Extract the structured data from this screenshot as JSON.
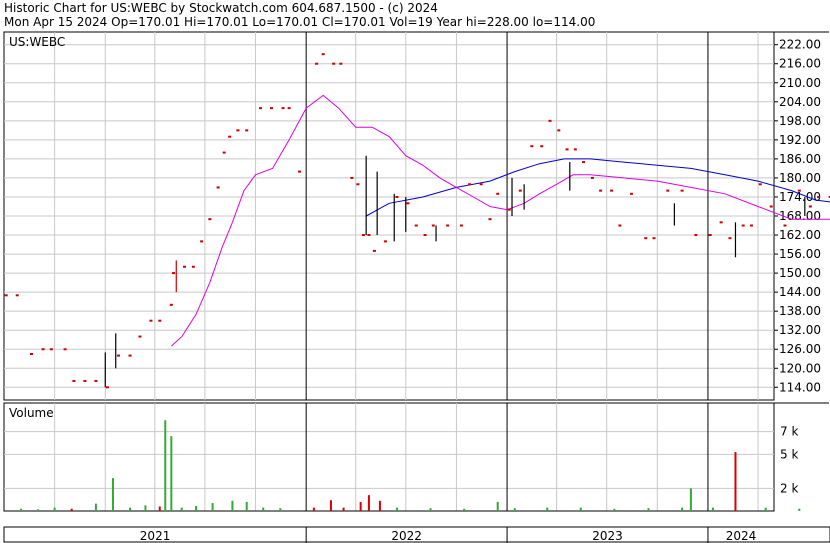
{
  "header": {
    "line1": "Historic Chart for US:WEBC by Stockwatch.com 604.687.1500 - (c) 2024",
    "line2": "Mon Apr 15 2024   Op=170.01  Hi=170.01  Lo=170.01  Cl=170.01  Vol=19   Year hi=228.00  lo=114.00"
  },
  "chart_data": [
    {
      "type": "line",
      "title": "US:WEBC",
      "y_ticks": [
        "222.00",
        "216.00",
        "210.00",
        "204.00",
        "198.00",
        "192.00",
        "186.00",
        "180.00",
        "174.00",
        "168.00",
        "162.00",
        "156.00",
        "150.00",
        "144.00",
        "138.00",
        "132.00",
        "126.00",
        "120.00",
        "114.00"
      ],
      "ylim": [
        110,
        226
      ],
      "x_labels": [
        "2021",
        "2022",
        "2023",
        "2024"
      ],
      "xlim": [
        "2020-07-01",
        "2024-04-30"
      ],
      "year_boundaries": [
        "2022-01-01",
        "2023-01-01",
        "2024-01-01"
      ],
      "grid": true,
      "colors": {
        "bars": "#cc0000",
        "up_bars": "#000000",
        "ma_long": "#0000cc",
        "ma_short": "#e000e0"
      },
      "price_points": [
        {
          "x": "2020-07-05",
          "y": 143
        },
        {
          "x": "2020-07-25",
          "y": 143
        },
        {
          "x": "2020-08-20",
          "y": 124.5
        },
        {
          "x": "2020-09-10",
          "y": 126
        },
        {
          "x": "2020-09-25",
          "y": 126
        },
        {
          "x": "2020-10-20",
          "y": 126
        },
        {
          "x": "2020-11-05",
          "y": 116
        },
        {
          "x": "2020-11-25",
          "y": 116
        },
        {
          "x": "2020-12-15",
          "y": 116
        },
        {
          "x": "2021-01-05",
          "y": 114
        },
        {
          "x": "2021-01-25",
          "y": 124
        },
        {
          "x": "2021-02-15",
          "y": 124
        },
        {
          "x": "2021-03-05",
          "y": 130
        },
        {
          "x": "2021-03-25",
          "y": 135
        },
        {
          "x": "2021-04-10",
          "y": 135
        },
        {
          "x": "2021-05-01",
          "y": 140
        },
        {
          "x": "2021-05-05",
          "y": 150
        },
        {
          "x": "2021-05-25",
          "y": 152
        },
        {
          "x": "2021-06-10",
          "y": 152
        },
        {
          "x": "2021-06-25",
          "y": 160
        },
        {
          "x": "2021-07-10",
          "y": 167
        },
        {
          "x": "2021-07-25",
          "y": 177
        },
        {
          "x": "2021-08-05",
          "y": 188
        },
        {
          "x": "2021-08-15",
          "y": 193
        },
        {
          "x": "2021-08-30",
          "y": 195
        },
        {
          "x": "2021-09-15",
          "y": 195
        },
        {
          "x": "2021-10-10",
          "y": 202
        },
        {
          "x": "2021-10-30",
          "y": 202
        },
        {
          "x": "2021-11-20",
          "y": 202
        },
        {
          "x": "2021-12-01",
          "y": 202
        },
        {
          "x": "2021-12-20",
          "y": 182
        },
        {
          "x": "2022-01-20",
          "y": 216
        },
        {
          "x": "2022-02-01",
          "y": 219
        },
        {
          "x": "2022-02-20",
          "y": 216
        },
        {
          "x": "2022-03-05",
          "y": 216
        },
        {
          "x": "2022-03-25",
          "y": 180
        },
        {
          "x": "2022-04-05",
          "y": 178
        },
        {
          "x": "2022-04-15",
          "y": 162
        },
        {
          "x": "2022-04-25",
          "y": 162
        },
        {
          "x": "2022-05-05",
          "y": 157
        },
        {
          "x": "2022-05-25",
          "y": 160
        },
        {
          "x": "2022-06-15",
          "y": 174
        },
        {
          "x": "2022-07-05",
          "y": 172
        },
        {
          "x": "2022-07-20",
          "y": 165
        },
        {
          "x": "2022-08-05",
          "y": 162
        },
        {
          "x": "2022-08-20",
          "y": 165
        },
        {
          "x": "2022-09-15",
          "y": 165
        },
        {
          "x": "2022-10-10",
          "y": 165
        },
        {
          "x": "2022-10-25",
          "y": 178
        },
        {
          "x": "2022-11-15",
          "y": 178
        },
        {
          "x": "2022-12-01",
          "y": 167
        },
        {
          "x": "2022-12-15",
          "y": 175
        },
        {
          "x": "2023-01-05",
          "y": 170
        },
        {
          "x": "2023-01-25",
          "y": 176
        },
        {
          "x": "2023-02-15",
          "y": 190
        },
        {
          "x": "2023-03-05",
          "y": 190
        },
        {
          "x": "2023-03-20",
          "y": 198
        },
        {
          "x": "2023-04-05",
          "y": 195
        },
        {
          "x": "2023-04-20",
          "y": 189
        },
        {
          "x": "2023-05-05",
          "y": 189
        },
        {
          "x": "2023-05-20",
          "y": 185
        },
        {
          "x": "2023-06-05",
          "y": 180
        },
        {
          "x": "2023-06-20",
          "y": 176
        },
        {
          "x": "2023-07-10",
          "y": 176
        },
        {
          "x": "2023-07-25",
          "y": 165
        },
        {
          "x": "2023-08-15",
          "y": 175
        },
        {
          "x": "2023-09-10",
          "y": 161
        },
        {
          "x": "2023-09-25",
          "y": 161
        },
        {
          "x": "2023-10-20",
          "y": 176
        },
        {
          "x": "2023-11-15",
          "y": 176
        },
        {
          "x": "2023-12-10",
          "y": 162
        },
        {
          "x": "2024-01-05",
          "y": 162
        },
        {
          "x": "2024-01-25",
          "y": 166
        },
        {
          "x": "2024-02-10",
          "y": 161
        },
        {
          "x": "2024-03-05",
          "y": 165
        },
        {
          "x": "2024-03-20",
          "y": 165
        },
        {
          "x": "2024-04-05",
          "y": 178
        },
        {
          "x": "2024-04-25",
          "y": 171
        },
        {
          "x": "2024-05-20",
          "y": 165
        },
        {
          "x": "2024-06-15",
          "y": 176
        },
        {
          "x": "2024-07-05",
          "y": 171
        },
        {
          "x": "2024-07-20",
          "y": 174
        },
        {
          "x": "2024-08-10",
          "y": 174
        },
        {
          "x": "2024-09-10",
          "y": 168
        },
        {
          "x": "2024-10-05",
          "y": 162
        },
        {
          "x": "2024-10-25",
          "y": 180
        },
        {
          "x": "2024-11-05",
          "y": 180
        },
        {
          "x": "2024-11-15",
          "y": 174
        }
      ],
      "range_bars": [
        {
          "x": "2021-01-01",
          "lo": 114,
          "hi": 125,
          "up": true
        },
        {
          "x": "2021-01-20",
          "lo": 120,
          "hi": 131,
          "up": true
        },
        {
          "x": "2021-05-10",
          "lo": 144,
          "hi": 154,
          "up": false
        },
        {
          "x": "2022-04-20",
          "lo": 162,
          "hi": 187,
          "up": true
        },
        {
          "x": "2022-05-10",
          "lo": 162,
          "hi": 182,
          "up": true
        },
        {
          "x": "2022-06-10",
          "lo": 160,
          "hi": 175,
          "up": true
        },
        {
          "x": "2022-07-01",
          "lo": 163,
          "hi": 174,
          "up": true
        },
        {
          "x": "2022-08-25",
          "lo": 160,
          "hi": 165,
          "up": true
        },
        {
          "x": "2023-01-10",
          "lo": 168,
          "hi": 180,
          "up": true
        },
        {
          "x": "2023-02-01",
          "lo": 170,
          "hi": 178,
          "up": true
        },
        {
          "x": "2023-04-25",
          "lo": 176,
          "hi": 185,
          "up": true
        },
        {
          "x": "2023-11-01",
          "lo": 165,
          "hi": 172,
          "up": true
        },
        {
          "x": "2024-02-20",
          "lo": 155,
          "hi": 166,
          "up": true
        },
        {
          "x": "2024-06-25",
          "lo": 168,
          "hi": 174,
          "up": true
        },
        {
          "x": "2024-09-20",
          "lo": 168,
          "hi": 176,
          "up": true
        }
      ],
      "series": [
        {
          "values": [
            {
              "x": "2022-04-20",
              "y": 168
            },
            {
              "x": "2022-06-01",
              "y": 172
            },
            {
              "x": "2022-08-01",
              "y": 174
            },
            {
              "x": "2022-10-01",
              "y": 177
            },
            {
              "x": "2022-12-01",
              "y": 179
            },
            {
              "x": "2023-01-15",
              "y": 182
            },
            {
              "x": "2023-03-01",
              "y": 184.5
            },
            {
              "x": "2023-04-15",
              "y": 186
            },
            {
              "x": "2023-06-01",
              "y": 186
            },
            {
              "x": "2023-08-01",
              "y": 185
            },
            {
              "x": "2023-10-01",
              "y": 184
            },
            {
              "x": "2023-12-01",
              "y": 183
            },
            {
              "x": "2024-02-01",
              "y": 181
            },
            {
              "x": "2024-04-01",
              "y": 179
            },
            {
              "x": "2024-06-01",
              "y": 176
            },
            {
              "x": "2024-07-15",
              "y": 173
            },
            {
              "x": "2024-09-01",
              "y": 172
            },
            {
              "x": "2024-10-15",
              "y": 172
            },
            {
              "x": "2024-11-15",
              "y": 172
            }
          ]
        },
        {
          "values": [
            {
              "x": "2021-05-01",
              "y": 127
            },
            {
              "x": "2021-05-20",
              "y": 130
            },
            {
              "x": "2021-06-15",
              "y": 137
            },
            {
              "x": "2021-07-10",
              "y": 147
            },
            {
              "x": "2021-08-01",
              "y": 158
            },
            {
              "x": "2021-08-20",
              "y": 166
            },
            {
              "x": "2021-09-10",
              "y": 176
            },
            {
              "x": "2021-10-01",
              "y": 181
            },
            {
              "x": "2021-11-01",
              "y": 183
            },
            {
              "x": "2021-12-01",
              "y": 192
            },
            {
              "x": "2022-01-01",
              "y": 202
            },
            {
              "x": "2022-02-01",
              "y": 206
            },
            {
              "x": "2022-03-01",
              "y": 202
            },
            {
              "x": "2022-04-01",
              "y": 196
            },
            {
              "x": "2022-05-01",
              "y": 196
            },
            {
              "x": "2022-06-01",
              "y": 193
            },
            {
              "x": "2022-07-01",
              "y": 187
            },
            {
              "x": "2022-08-01",
              "y": 184
            },
            {
              "x": "2022-09-01",
              "y": 180
            },
            {
              "x": "2022-10-01",
              "y": 177
            },
            {
              "x": "2022-11-01",
              "y": 174
            },
            {
              "x": "2022-12-01",
              "y": 171
            },
            {
              "x": "2023-01-01",
              "y": 170
            },
            {
              "x": "2023-02-01",
              "y": 172
            },
            {
              "x": "2023-03-01",
              "y": 175
            },
            {
              "x": "2023-04-01",
              "y": 178
            },
            {
              "x": "2023-05-01",
              "y": 181
            },
            {
              "x": "2023-06-01",
              "y": 181
            },
            {
              "x": "2023-08-01",
              "y": 180
            },
            {
              "x": "2023-10-01",
              "y": 179
            },
            {
              "x": "2023-12-01",
              "y": 177
            },
            {
              "x": "2024-02-01",
              "y": 175
            },
            {
              "x": "2024-04-01",
              "y": 171
            },
            {
              "x": "2024-06-01",
              "y": 167
            },
            {
              "x": "2024-07-15",
              "y": 167
            },
            {
              "x": "2024-09-01",
              "y": 167
            },
            {
              "x": "2024-10-01",
              "y": 168
            },
            {
              "x": "2024-11-01",
              "y": 170
            },
            {
              "x": "2024-11-15",
              "y": 170
            }
          ]
        }
      ]
    },
    {
      "type": "bar",
      "title": "Volume",
      "y_ticks": [
        "7 k",
        "5 k",
        "2 k"
      ],
      "ylim": [
        0,
        9000
      ],
      "volume_bars": [
        {
          "x": "2020-08-01",
          "v": 200,
          "up": true
        },
        {
          "x": "2020-09-01",
          "v": 150,
          "up": true
        },
        {
          "x": "2020-10-01",
          "v": 300,
          "up": true
        },
        {
          "x": "2020-11-01",
          "v": 200,
          "up": false
        },
        {
          "x": "2020-12-15",
          "v": 650,
          "up": true
        },
        {
          "x": "2021-01-15",
          "v": 2900,
          "up": true
        },
        {
          "x": "2021-02-15",
          "v": 300,
          "up": true
        },
        {
          "x": "2021-03-15",
          "v": 500,
          "up": true
        },
        {
          "x": "2021-04-10",
          "v": 400,
          "up": false
        },
        {
          "x": "2021-04-20",
          "v": 8000,
          "up": true
        },
        {
          "x": "2021-05-01",
          "v": 6600,
          "up": true
        },
        {
          "x": "2021-05-20",
          "v": 300,
          "up": true
        },
        {
          "x": "2021-06-15",
          "v": 450,
          "up": true
        },
        {
          "x": "2021-07-15",
          "v": 700,
          "up": true
        },
        {
          "x": "2021-08-20",
          "v": 900,
          "up": true
        },
        {
          "x": "2021-09-15",
          "v": 800,
          "up": true
        },
        {
          "x": "2021-10-15",
          "v": 300,
          "up": true
        },
        {
          "x": "2021-11-15",
          "v": 250,
          "up": true
        },
        {
          "x": "2022-01-15",
          "v": 300,
          "up": false
        },
        {
          "x": "2022-02-15",
          "v": 950,
          "up": false
        },
        {
          "x": "2022-03-10",
          "v": 300,
          "up": false
        },
        {
          "x": "2022-04-10",
          "v": 800,
          "up": false
        },
        {
          "x": "2022-04-25",
          "v": 1400,
          "up": false
        },
        {
          "x": "2022-05-15",
          "v": 900,
          "up": false
        },
        {
          "x": "2022-06-15",
          "v": 300,
          "up": true
        },
        {
          "x": "2022-08-15",
          "v": 250,
          "up": true
        },
        {
          "x": "2022-10-15",
          "v": 200,
          "up": true
        },
        {
          "x": "2022-12-15",
          "v": 800,
          "up": true
        },
        {
          "x": "2023-01-15",
          "v": 250,
          "up": true
        },
        {
          "x": "2023-03-15",
          "v": 300,
          "up": true
        },
        {
          "x": "2023-05-15",
          "v": 300,
          "up": true
        },
        {
          "x": "2023-07-15",
          "v": 200,
          "up": true
        },
        {
          "x": "2023-09-15",
          "v": 250,
          "up": true
        },
        {
          "x": "2023-11-15",
          "v": 300,
          "up": true
        },
        {
          "x": "2023-12-01",
          "v": 2000,
          "up": true
        },
        {
          "x": "2024-01-10",
          "v": 300,
          "up": true
        },
        {
          "x": "2024-02-20",
          "v": 5200,
          "up": false
        },
        {
          "x": "2024-04-15",
          "v": 300,
          "up": true
        },
        {
          "x": "2024-06-15",
          "v": 200,
          "up": true
        },
        {
          "x": "2024-08-15",
          "v": 250,
          "up": true
        },
        {
          "x": "2024-10-15",
          "v": 150,
          "up": true
        }
      ]
    }
  ]
}
